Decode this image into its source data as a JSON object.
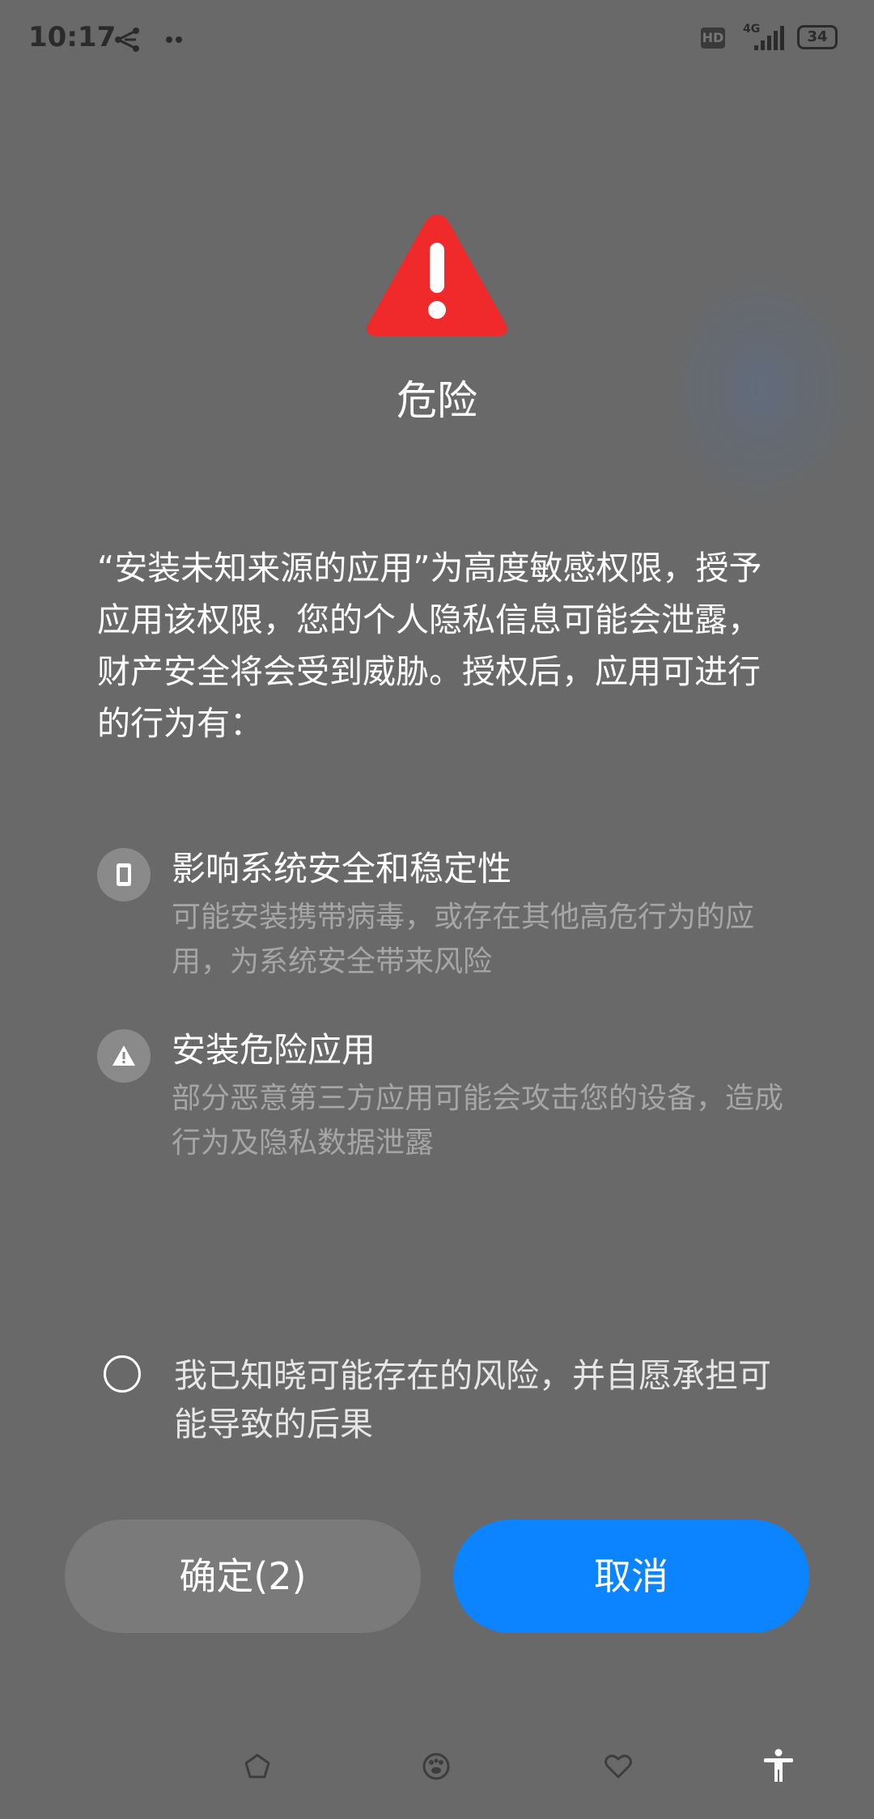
{
  "status_bar": {
    "time": "10:17",
    "network_label": "4G",
    "hd_label": "HD",
    "battery_level": "34",
    "icons": [
      "share-icon",
      "more-dots-icon",
      "signal-icon",
      "battery-icon"
    ]
  },
  "dialog": {
    "icon": "warning-triangle-icon",
    "icon_color": "#f02a2a",
    "title": "危险",
    "description": "“安装未知来源的应用”为高度敏感权限，授予应用该权限，您的个人隐私信息可能会泄露，财产安全将会受到威胁。授权后，应用可进行的行为有：",
    "risks": [
      {
        "icon": "device-icon",
        "title": "影响系统安全和稳定性",
        "desc": "可能安装携带病毒，或存在其他高危行为的应用，为系统安全带来风险"
      },
      {
        "icon": "warning-small-icon",
        "title": "安装危险应用",
        "desc": "部分恶意第三方应用可能会攻击您的设备，造成行为及隐私数据泄露"
      }
    ],
    "consent_text": "我已知晓可能存在的风险，并自愿承担可能导致的后果",
    "confirm_label": "确定(2)",
    "cancel_label": "取消",
    "accent_color": "#0d84ff"
  },
  "bottom_nav": {
    "icons": [
      "pentagon-icon",
      "paw-icon",
      "heart-icon",
      "accessibility-icon"
    ]
  }
}
